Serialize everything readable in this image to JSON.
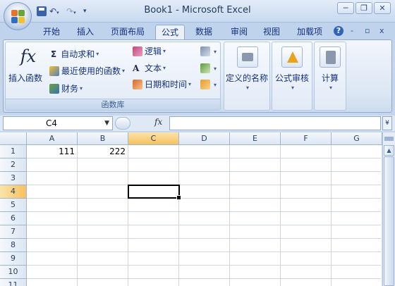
{
  "window": {
    "title": "Book1 - Microsoft Excel"
  },
  "qat": {
    "save_icon": "save-icon",
    "undo_icon": "undo-icon",
    "redo_icon": "redo-icon",
    "customize_icon": "chevron-down-icon"
  },
  "window_controls": {
    "minimize": "─",
    "restore": "❐",
    "close": "✕"
  },
  "tabs": [
    {
      "label": "开始"
    },
    {
      "label": "插入"
    },
    {
      "label": "页面布局"
    },
    {
      "label": "公式"
    },
    {
      "label": "数据"
    },
    {
      "label": "审阅"
    },
    {
      "label": "视图"
    },
    {
      "label": "加载项"
    }
  ],
  "active_tab": "公式",
  "tab_controls": {
    "help": "?",
    "minimize": "-",
    "restore": "▫",
    "close": "x"
  },
  "ribbon": {
    "function_library": {
      "group_label": "函数库",
      "insert_function": {
        "icon_text": "fx",
        "label": "插入函数"
      },
      "autosum": {
        "symbol": "Σ",
        "label": "自动求和"
      },
      "recently_used": {
        "label": "最近使用的函数"
      },
      "financial": {
        "label": "财务"
      },
      "logical": {
        "label": "逻辑"
      },
      "text": {
        "icon_text": "A",
        "label": "文本"
      },
      "date_time": {
        "label": "日期和时间"
      }
    },
    "defined_names": {
      "label": "定义的名称"
    },
    "formula_auditing": {
      "label": "公式审核"
    },
    "calculation": {
      "label": "计算"
    }
  },
  "formula_bar": {
    "name_box": "C4",
    "fx_label": "fx",
    "formula": "",
    "expand": "¥"
  },
  "sheet": {
    "columns": [
      "A",
      "B",
      "C",
      "D",
      "E",
      "F",
      "G"
    ],
    "rows": [
      "1",
      "2",
      "3",
      "4",
      "5",
      "6",
      "7",
      "8",
      "9",
      "10",
      "11"
    ],
    "selected_column": "C",
    "selected_row": "4",
    "cells": {
      "A1": "111",
      "B1": "222"
    }
  },
  "colors": {
    "ribbon_bg": "#dbe6f4",
    "selection_header": "#f7c05f",
    "grid_line": "#d0d7e5"
  }
}
